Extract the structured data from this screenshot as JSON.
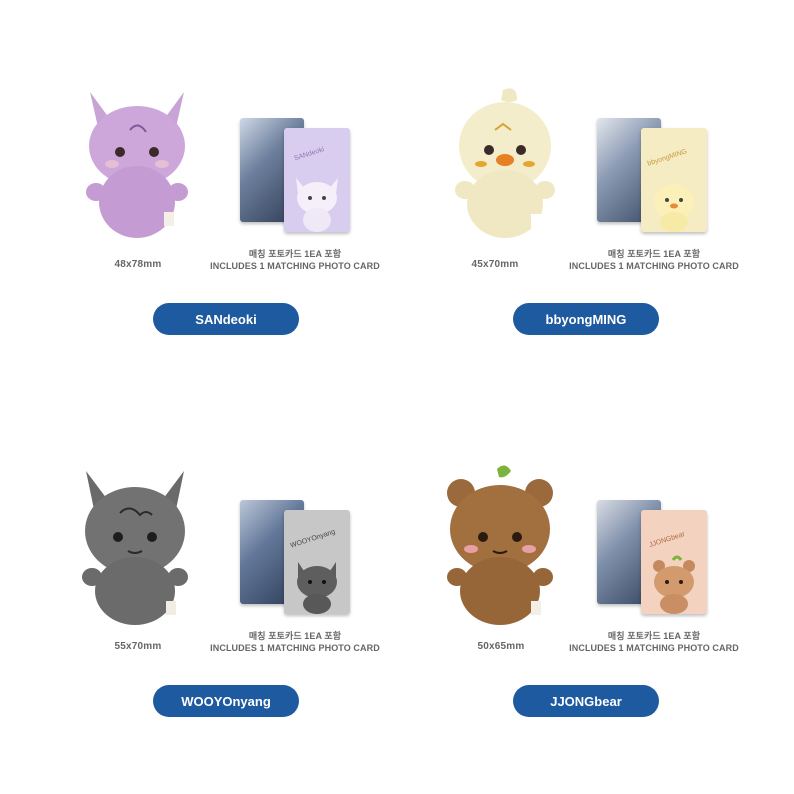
{
  "products": [
    {
      "name": "SANdeoki",
      "size": "48x78mm",
      "note_kr": "매칭 포토카드 1EA 포함",
      "note_en": "INCLUDES 1 MATCHING PHOTO CARD",
      "plush_color": "#c9a2d6",
      "card_color": "#d9cdef",
      "card_label": "SANdeoki"
    },
    {
      "name": "bbyongMING",
      "size": "45x70mm",
      "note_kr": "매칭 포토카드 1EA 포함",
      "note_en": "INCLUDES 1 MATCHING PHOTO CARD",
      "plush_color": "#f3ecc8",
      "card_color": "#f5ecc4",
      "card_label": "bbyongMING"
    },
    {
      "name": "WOOYOnyang",
      "size": "55x70mm",
      "note_kr": "매칭 포토카드 1EA 포함",
      "note_en": "INCLUDES 1 MATCHING PHOTO CARD",
      "plush_color": "#6e6e6e",
      "card_color": "#c7c7c7",
      "card_label": "WOOYOnyang"
    },
    {
      "name": "JJONGbear",
      "size": "50x65mm",
      "note_kr": "매칭 포토카드 1EA 포함",
      "note_en": "INCLUDES 1 MATCHING PHOTO CARD",
      "plush_color": "#9a6a3c",
      "card_color": "#f3d2bf",
      "card_label": "JJONGbear"
    }
  ],
  "button_color": "#1e5aa0"
}
